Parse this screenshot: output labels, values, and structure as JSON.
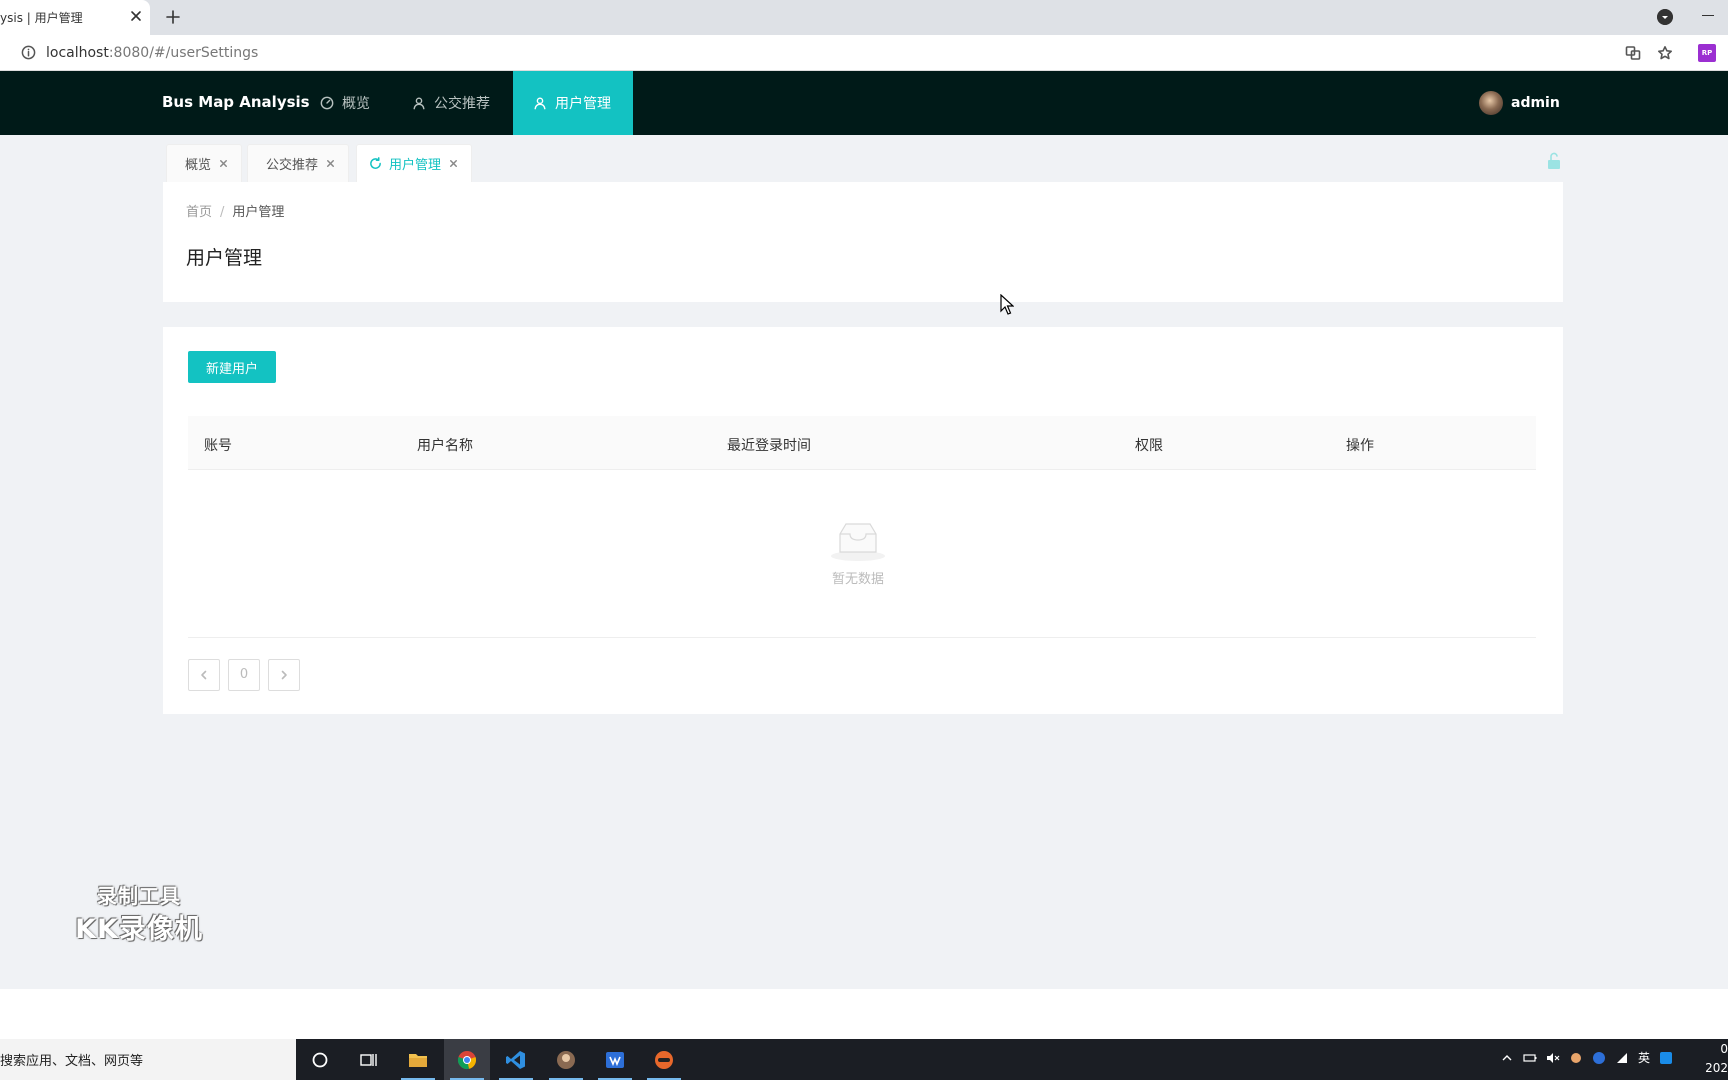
{
  "browser": {
    "tab_title": "ysis | 用户管理",
    "url_host": "localhost",
    "url_rest": ":8080/#/userSettings",
    "ext_label": "RP"
  },
  "header": {
    "brand": "Bus Map Analysis",
    "nav": [
      {
        "label": "概览",
        "icon": "dashboard-icon",
        "active": false
      },
      {
        "label": "公交推荐",
        "icon": "user-icon",
        "active": false
      },
      {
        "label": "用户管理",
        "icon": "user-icon",
        "active": true
      }
    ],
    "username": "admin"
  },
  "page_tabs": [
    {
      "label": "概览",
      "active": false
    },
    {
      "label": "公交推荐",
      "active": false
    },
    {
      "label": "用户管理",
      "active": true
    }
  ],
  "breadcrumb": {
    "home": "首页",
    "sep": "/",
    "current": "用户管理"
  },
  "page_title": "用户管理",
  "toolbar": {
    "new_user_label": "新建用户"
  },
  "table": {
    "columns": [
      "账号",
      "用户名称",
      "最近登录时间",
      "权限",
      "操作"
    ],
    "rows": [],
    "empty_text": "暂无数据"
  },
  "pagination": {
    "current": "0"
  },
  "watermark": {
    "line1": "录制工具",
    "line2": "KK录像机"
  },
  "taskbar": {
    "search_text": "搜索应用、文档、网页等",
    "ime": "英",
    "clock_line1": "0",
    "clock_line2": "202"
  },
  "colors": {
    "accent": "#13c2c2",
    "header_bg": "#001a18",
    "page_bg": "#f0f2f5"
  }
}
